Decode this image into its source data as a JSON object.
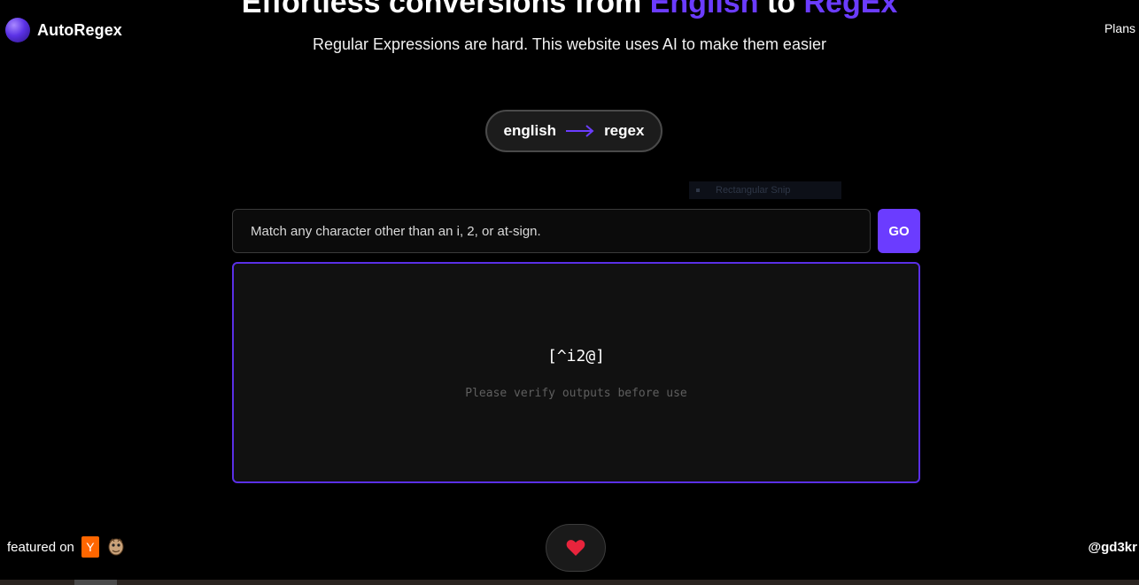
{
  "brand": {
    "name": "AutoRegex",
    "accent_color": "#6b3cff"
  },
  "nav": {
    "plans_label": "Plans"
  },
  "hero": {
    "title_part1": "Effortless conversions from ",
    "title_accent1": "English",
    "title_part2": " to ",
    "title_accent2": "RegEx",
    "subtitle": "Regular Expressions are hard. This website uses AI to make them easier"
  },
  "mode": {
    "from": "english",
    "to": "regex",
    "icon": "arrow-right-icon"
  },
  "snip_overlay": {
    "label": "Rectangular Snip"
  },
  "query": {
    "value": "Match any character other than an i, 2, or at-sign.",
    "go_label": "GO"
  },
  "output": {
    "regex": "[^i2@]",
    "note": "Please verify outputs before use"
  },
  "footer": {
    "featured_label": "featured on",
    "yc_glyph": "Y",
    "heart_icon": "heart-icon",
    "author": "@gd3kr"
  }
}
